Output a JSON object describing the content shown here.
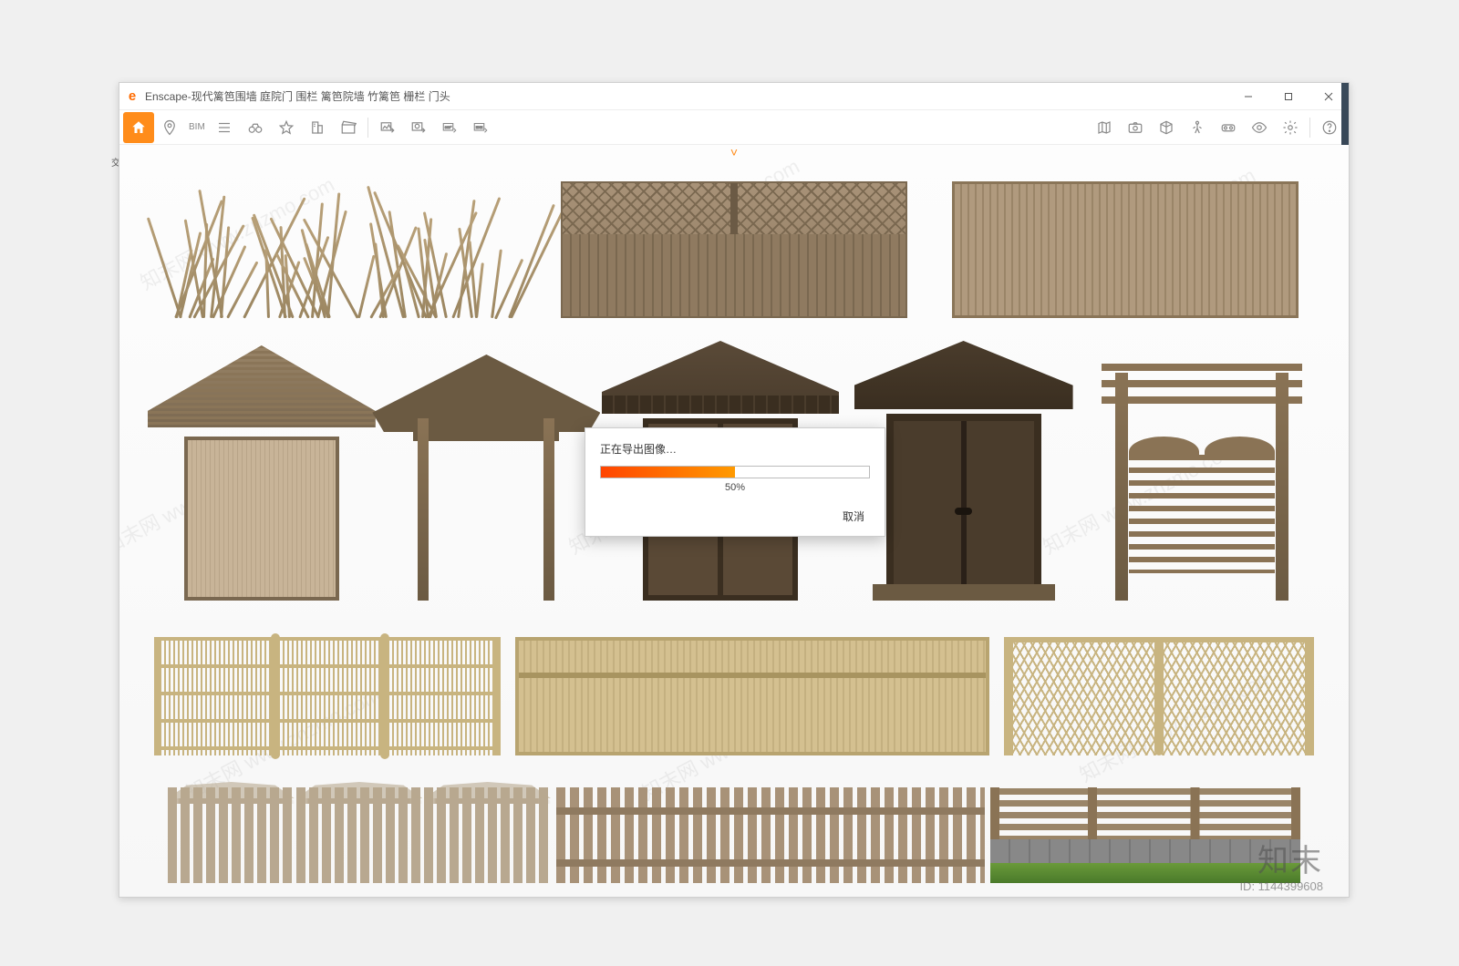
{
  "app": {
    "icon_letter": "e",
    "name": "Enscape",
    "title_sep": " - ",
    "document": "现代篱笆围墙 庭院门 围栏 篱笆院墙 竹篱笆 栅栏 门头"
  },
  "window_controls": {
    "minimize": "minimize",
    "maximize": "maximize",
    "close": "close"
  },
  "toolbar": {
    "home": "home",
    "pin": "pin",
    "bim_label": "BIM",
    "menu": "menu",
    "binoculars": "binoculars",
    "favorite": "favorite",
    "building": "building",
    "clapper": "clapper",
    "export_img": "export-image",
    "export_pano": "export-pano",
    "export_360": "export-360",
    "export_exe": "export-exe",
    "right": {
      "map": "map",
      "screenshot": "screenshot",
      "cube": "cube",
      "walk": "walk",
      "vr": "vr",
      "eye": "eye",
      "settings": "settings",
      "help": "help"
    }
  },
  "dialog": {
    "title": "正在导出图像…",
    "percent_value": 50,
    "percent_label": "50%",
    "cancel": "取消"
  },
  "watermark_text": "知末网 www.znzmo.com",
  "brand": "知末",
  "id_label": "ID: 1144399608",
  "top_chevron": "˅"
}
